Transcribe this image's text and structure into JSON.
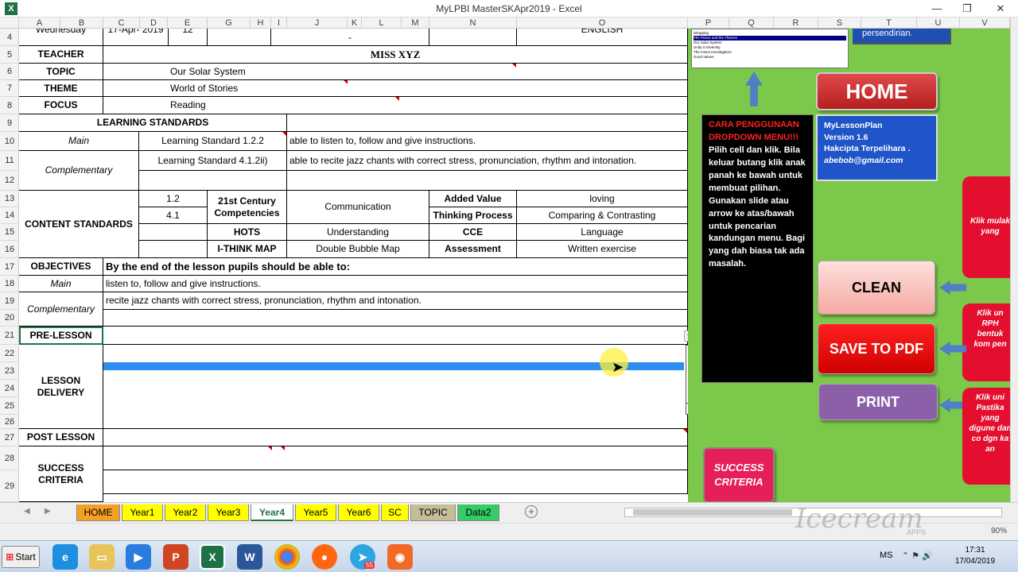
{
  "window": {
    "title": "MyLPBI MasterSKApr2019 - Excel",
    "app_icon": "X",
    "minimize": "—",
    "restore": "❐",
    "close": "✕"
  },
  "columns": [
    "A",
    "B",
    "C",
    "D",
    "E",
    "F",
    "G",
    "H",
    "I",
    "J",
    "K",
    "L",
    "M",
    "N",
    "O",
    "P",
    "Q",
    "R",
    "S",
    "T",
    "U",
    "V"
  ],
  "rows": [
    "4",
    "5",
    "6",
    "7",
    "8",
    "9",
    "10",
    "11",
    "12",
    "13",
    "14",
    "15",
    "16",
    "17",
    "18",
    "19",
    "20",
    "21",
    "22",
    "23",
    "24",
    "25",
    "26",
    "27",
    "28",
    "29"
  ],
  "lesson": {
    "day": "Wednesday",
    "date": "17-Apr- 2019",
    "class_no": "12",
    "dash": "-",
    "subject": "ENGLISH",
    "teacher_label": "TEACHER",
    "teacher": "MISS XYZ",
    "topic_label": "TOPIC",
    "topic": "Our Solar System",
    "theme_label": "THEME",
    "theme": "World of Stories",
    "focus_label": "FOCUS",
    "focus": "Reading",
    "ls_header": "LEARNING STANDARDS",
    "main_label": "Main",
    "ls_main": "Learning Standard 1.2.2",
    "ls_main_desc": "able to listen to, follow and give instructions.",
    "comp_label": "Complementary",
    "ls_comp": "Learning Standard 4.1.2ii)",
    "ls_comp_desc": "able to recite jazz chants with correct stress, pronunciation, rhythm and intonation.",
    "cs_label": "CONTENT STANDARDS",
    "cs1": "1.2",
    "cs2": "4.1",
    "c21_label": "21st Century Competencies",
    "c21": "Communication",
    "av_label": "Added Value",
    "av": "loving",
    "tp_label": "Thinking Process",
    "tp": "Comparing & Contrasting",
    "hots_label": "HOTS",
    "hots": "Understanding",
    "cce_label": "CCE",
    "cce": "Language",
    "ithink_label": "I-THINK MAP",
    "ithink": "Double Bubble Map",
    "assess_label": "Assessment",
    "assess": "Written exercise",
    "obj_label": "OBJECTIVES",
    "obj_intro": "By the end of the lesson pupils should be able to:",
    "obj_main_label": "Main",
    "obj_main": "listen to, follow and give instructions.",
    "obj_comp_label": "Complementary",
    "obj_comp": "recite jazz chants with correct stress, pronunciation, rhythm and intonation.",
    "pre_label": "PRE-LESSON",
    "delivery_label": "LESSON DELIVERY",
    "post_label": "POST LESSON",
    "sc_label": "SUCCESS CRITERIA"
  },
  "panel": {
    "list_items": [
      "Shopping",
      "The Prince and the Thieves",
      "Our Solar System",
      "Unity in Diversity",
      "The Insect Investigators",
      "Good Values"
    ],
    "persendirian": "persendirian.",
    "home": "HOME",
    "help_title": "CARA PENGGUNAAN DROPDOWN MENU!!!",
    "help_body": "Pilih cell dan klik. Bila keluar butang klik anak panah ke bawah untuk membuat pilihan. Gunakan slide atau arrow ke atas/bawah untuk pencarian kandungan menu. Bagi yang dah biasa tak ada masalah.",
    "info_l1": "MyLessonPlan",
    "info_l2": "Version 1.6",
    "info_l3": "Hakcipta Terpelihara .",
    "info_l4": "abebob@gmail.com",
    "clean": "CLEAN",
    "save_pdf": "SAVE TO PDF",
    "print": "PRINT",
    "success": "SUCCESS CRITERIA",
    "side1": "Klik mulak yang",
    "side2": "Klik un RPH bentuk kom pen",
    "side3": "Klik uni Pastika yang digune dan co dgn ka an"
  },
  "tabs": [
    {
      "label": "HOME",
      "color": "#f4a024"
    },
    {
      "label": "Year1",
      "color": "#ffff00"
    },
    {
      "label": "Year2",
      "color": "#ffff00"
    },
    {
      "label": "Year3",
      "color": "#ffff00"
    },
    {
      "label": "Year4",
      "color": "#ffffff"
    },
    {
      "label": "Year5",
      "color": "#ffff00"
    },
    {
      "label": "Year6",
      "color": "#ffff00"
    },
    {
      "label": "SC",
      "color": "#ffff00"
    },
    {
      "label": "TOPIC",
      "color": "#c4bd97"
    },
    {
      "label": "Data2",
      "color": "#33cc66"
    }
  ],
  "status": {
    "zoom": "90%",
    "watermark": "Icecream",
    "apps": "APPS"
  },
  "taskbar": {
    "start": "Start",
    "lang": "MS",
    "time": "17:31",
    "date": "17/04/2019",
    "badge": "55"
  }
}
